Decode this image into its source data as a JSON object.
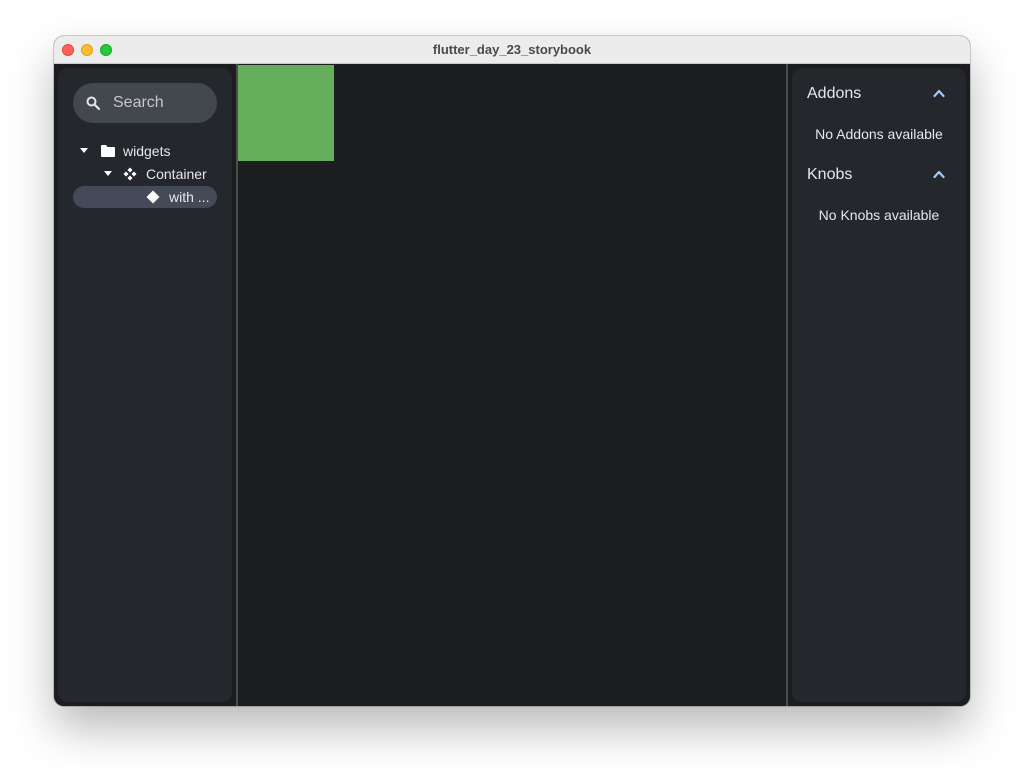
{
  "window": {
    "title": "flutter_day_23_storybook"
  },
  "sidebar": {
    "search": {
      "placeholder": "Search",
      "icon": "search-icon"
    },
    "tree": [
      {
        "label": "widgets",
        "icon": "folder-icon",
        "expanded": true,
        "level": 0
      },
      {
        "label": "Container",
        "icon": "component-icon",
        "expanded": true,
        "level": 1
      },
      {
        "label": "with ...",
        "icon": "story-icon",
        "selected": true,
        "level": 2
      }
    ]
  },
  "canvas": {
    "preview_color": "#66ae5b"
  },
  "panel": {
    "sections": [
      {
        "title": "Addons",
        "empty_text": "No Addons available",
        "expanded": true
      },
      {
        "title": "Knobs",
        "empty_text": "No Knobs available",
        "expanded": true
      }
    ]
  },
  "colors": {
    "accent": "#a8c7fa",
    "selection": "#444a57",
    "panel_bg": "#24272c",
    "canvas_bg": "#1c1d1f"
  }
}
